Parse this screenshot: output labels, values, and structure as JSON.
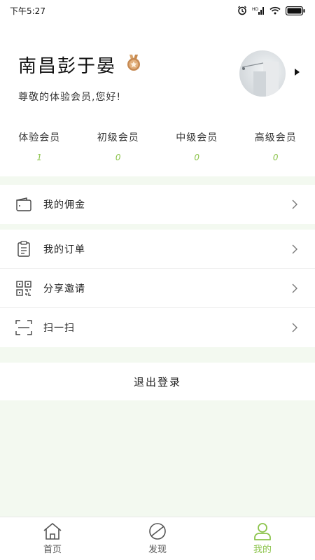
{
  "status_bar": {
    "time": "下午5:27"
  },
  "profile": {
    "name": "南昌彭于晏",
    "greeting": "尊敬的体验会员,您好!"
  },
  "levels": [
    {
      "name": "体验会员",
      "count": "1"
    },
    {
      "name": "初级会员",
      "count": "0"
    },
    {
      "name": "中级会员",
      "count": "0"
    },
    {
      "name": "高级会员",
      "count": "0"
    }
  ],
  "menu": {
    "commission": "我的佣金",
    "orders": "我的订单",
    "invite": "分享邀请",
    "scan": "扫一扫"
  },
  "logout_label": "退出登录",
  "tabs": [
    {
      "label": "首页",
      "icon": "home-icon"
    },
    {
      "label": "发现",
      "icon": "discover-icon"
    },
    {
      "label": "我的",
      "icon": "user-icon"
    }
  ],
  "colors": {
    "accent": "#8bc34a",
    "background": "#f3f9f0"
  }
}
